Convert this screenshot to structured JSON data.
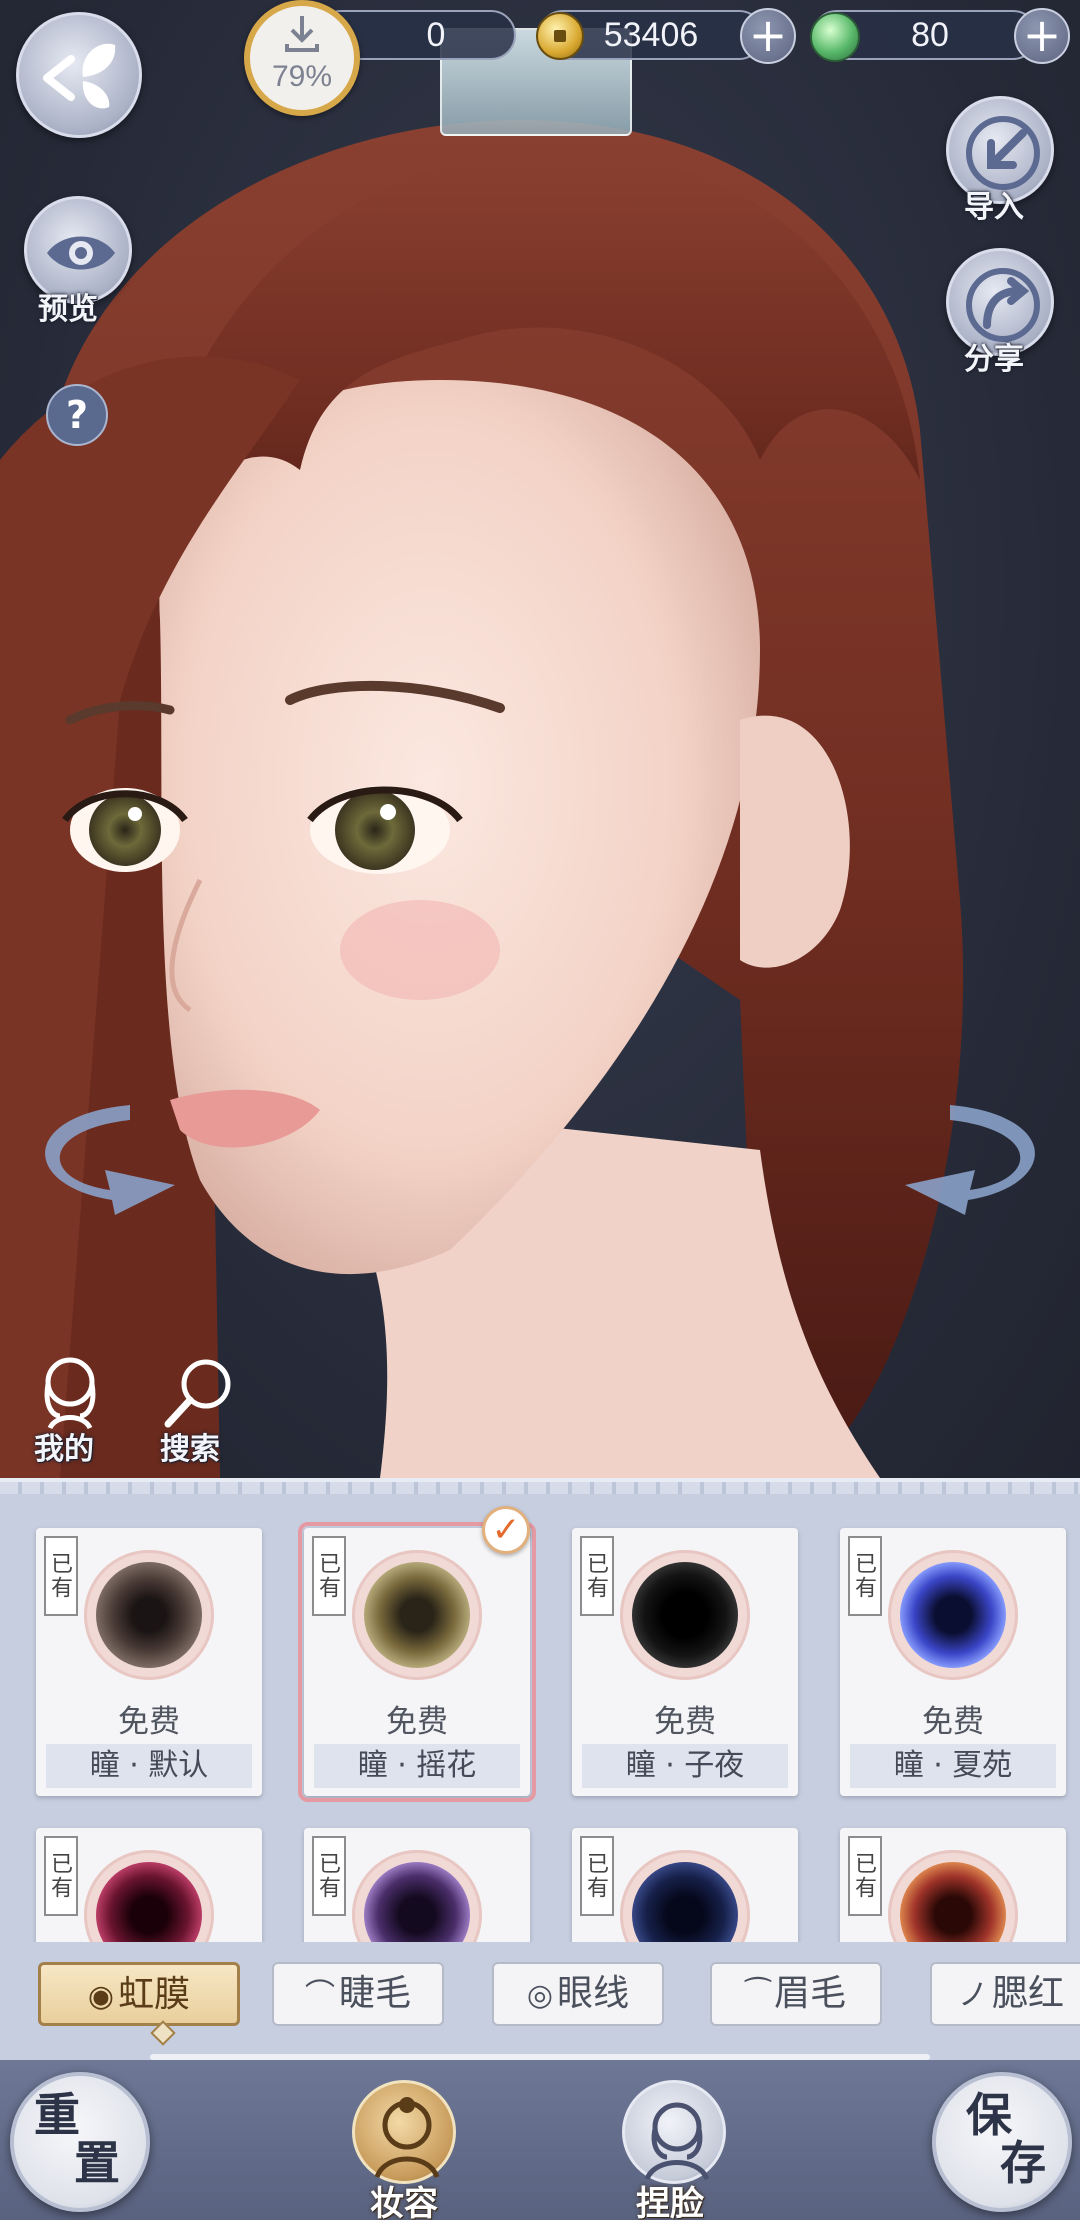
{
  "top_bar": {
    "download_progress": "79%",
    "download_count": "0",
    "coins": "53406",
    "jade": "80",
    "plus_symbol": "+"
  },
  "left_controls": {
    "back_icon": "butterfly-back-icon",
    "preview_label": "预览",
    "help_symbol": "?"
  },
  "right_controls": {
    "import_label": "导入",
    "share_label": "分享"
  },
  "scene_shortcuts": {
    "mine_label": "我的",
    "search_label": "搜索"
  },
  "cards": [
    {
      "owned_tag": "已有",
      "price": "免费",
      "name": "瞳 · 默认",
      "eye_color": "#4a3b36",
      "selected": false
    },
    {
      "owned_tag": "已有",
      "price": "免费",
      "name": "瞳 · 摇花",
      "eye_color": "#7a6a3c",
      "selected": true
    },
    {
      "owned_tag": "已有",
      "price": "免费",
      "name": "瞳 · 子夜",
      "eye_color": "#141414",
      "selected": false
    },
    {
      "owned_tag": "已有",
      "price": "免费",
      "name": "瞳 · 夏苑",
      "eye_color": "#3b46c8",
      "selected": false
    },
    {
      "owned_tag": "已有",
      "eye_color": "#6a1430"
    },
    {
      "owned_tag": "已有",
      "eye_color": "#4a2e6a"
    },
    {
      "owned_tag": "已有",
      "eye_color": "#16204a"
    },
    {
      "owned_tag": "已有",
      "eye_color": "#a0342a"
    }
  ],
  "tabs": [
    {
      "label": "虹膜",
      "icon": "iris-icon",
      "active": true
    },
    {
      "label": "睫毛",
      "icon": "eyelash-icon",
      "active": false
    },
    {
      "label": "眼线",
      "icon": "eye-icon",
      "active": false
    },
    {
      "label": "眉毛",
      "icon": "eyebrow-icon",
      "active": false
    },
    {
      "label": "腮红",
      "icon": "blush-icon",
      "active": false
    }
  ],
  "bottom_nav": {
    "reset_top": "重",
    "reset_bottom": "置",
    "makeup_label": "妆容",
    "face_label": "捏脸",
    "save_top": "保",
    "save_bottom": "存"
  },
  "colors": {
    "accent_gold": "#d6a849",
    "selected_outline": "#e59aa3",
    "panel_bg": "#c6cedf",
    "nav_bg": "#5f6886"
  }
}
